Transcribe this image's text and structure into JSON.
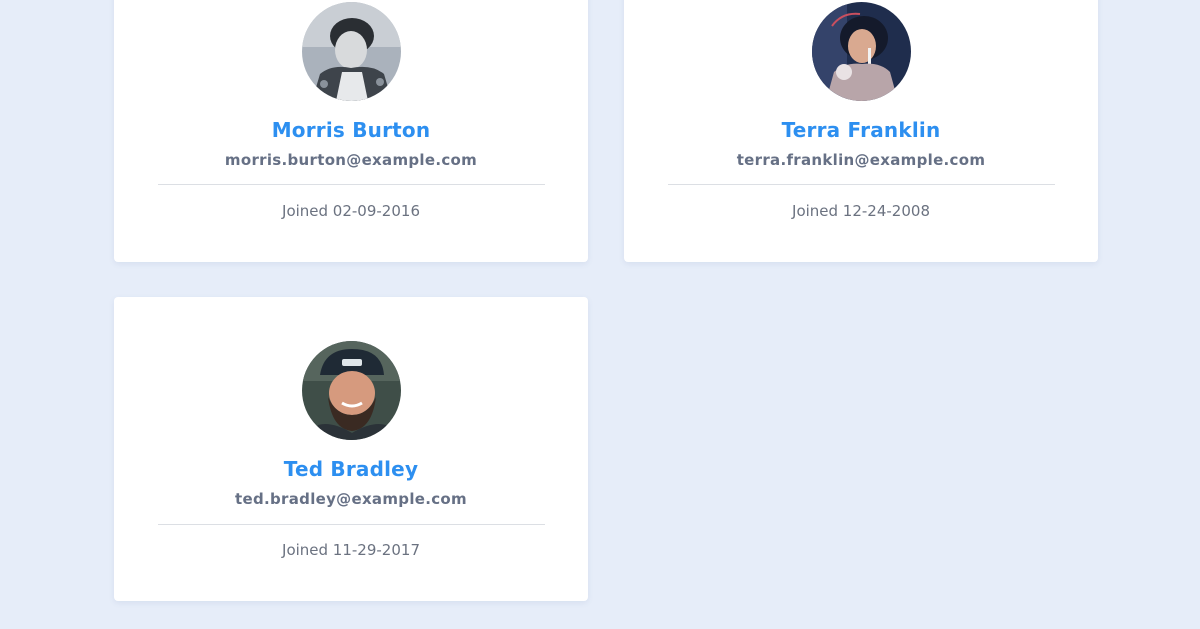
{
  "users": [
    {
      "name": "Morris Burton",
      "email": "morris.burton@example.com",
      "joined": "Joined 02-09-2016",
      "avatar": "black-and-white portrait photo"
    },
    {
      "name": "Terra Franklin",
      "email": "terra.franklin@example.com",
      "joined": "Joined 12-24-2008",
      "avatar": "portrait photo, drinking through a straw"
    },
    {
      "name": "Ted Bradley",
      "email": "ted.bradley@example.com",
      "joined": "Joined 11-29-2017",
      "avatar": "portrait photo, bearded man in a cap"
    }
  ],
  "colors": {
    "background": "#e6edf9",
    "card": "#ffffff",
    "name_accent": "#2d8ff0",
    "email_text": "#667085",
    "joined_text": "#6b7280",
    "divider": "#dcdfe4"
  }
}
